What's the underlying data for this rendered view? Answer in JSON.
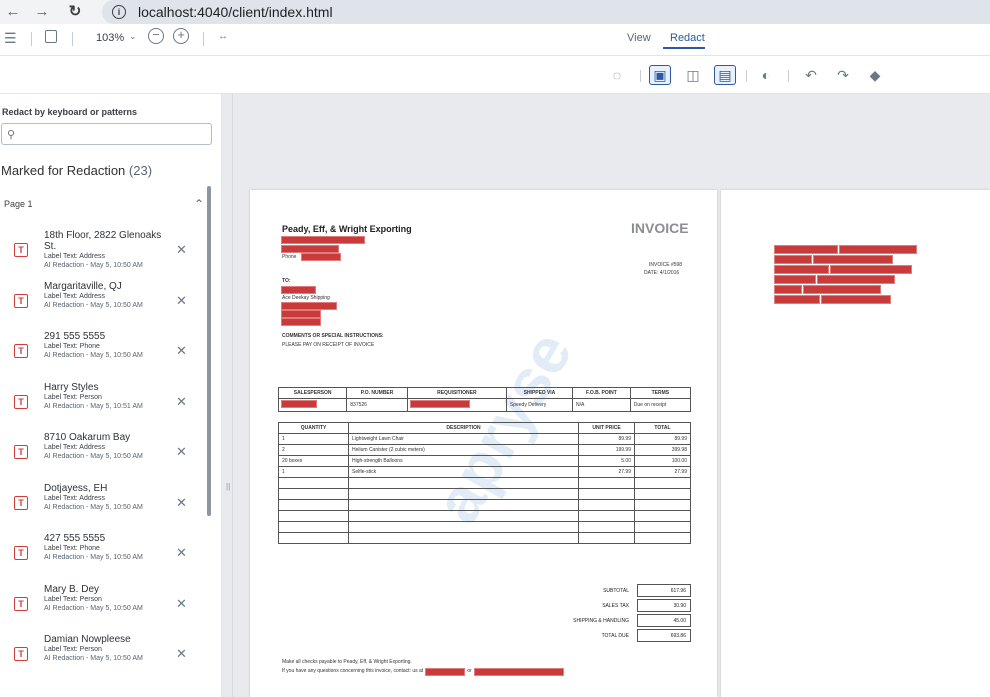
{
  "browser": {
    "url": "localhost:4040/client/index.html",
    "back_icon": "arrow-left-icon",
    "forward_icon": "arrow-right-icon",
    "reload_icon": "reload-icon"
  },
  "header": {
    "zoom": "103%",
    "tabs": [
      {
        "label": "View"
      },
      {
        "label": "Redact"
      }
    ],
    "active_tab": "Redact"
  },
  "sidebar": {
    "title": "Redact by keyboard or patterns",
    "search_placeholder": "",
    "marked_label": "Marked for Redaction",
    "marked_count": "(23)",
    "page_label": "Page 1",
    "items": [
      {
        "title": "18th Floor, 2822 Glenoaks St.",
        "type": "Label Text: Address",
        "meta": "AI Redaction - May 5, 10:50 AM"
      },
      {
        "title": "Margaritaville, QJ",
        "type": "Label Text: Address",
        "meta": "AI Redaction - May 5, 10:50 AM"
      },
      {
        "title": "291 555 5555",
        "type": "Label Text: Phone",
        "meta": "AI Redaction - May 5, 10:50 AM"
      },
      {
        "title": "Harry Styles",
        "type": "Label Text: Person",
        "meta": "AI Redaction - May 5, 10:51 AM"
      },
      {
        "title": "8710 Oakarum Bay",
        "type": "Label Text: Address",
        "meta": "AI Redaction - May 5, 10:50 AM"
      },
      {
        "title": "Dotjayess, EH",
        "type": "Label Text: Address",
        "meta": "AI Redaction - May 5, 10:50 AM"
      },
      {
        "title": "427 555 5555",
        "type": "Label Text: Phone",
        "meta": "AI Redaction - May 5, 10:50 AM"
      },
      {
        "title": "Mary B. Dey",
        "type": "Label Text: Person",
        "meta": "AI Redaction - May 5, 10:50 AM"
      },
      {
        "title": "Damian Nowpleese",
        "type": "Label Text: Person",
        "meta": "AI Redaction - May 5, 10:50 AM"
      }
    ]
  },
  "document": {
    "company": "Peady, Eff, & Wright Exporting",
    "invoice_title": "INVOICE",
    "phone_label": "Phone",
    "invoice_no": "INVOICE #598",
    "date": "DATE: 4/1/2016",
    "to_label": "TO:",
    "to_company": "Ace Deekay Shipping",
    "comments_label": "COMMENTS OR SPECIAL INSTRUCTIONS:",
    "comments_text": "PLEASE PAY ON RECEIPT OF INVOICE",
    "top_table": {
      "headers": [
        "SALESPERSON",
        "P.O. NUMBER",
        "REQUISITIONER",
        "SHIPPED VIA",
        "F.O.B. POINT",
        "TERMS"
      ],
      "row": [
        "",
        "837526",
        "",
        "Speedy Delivery",
        "N/A",
        "Due on receipt"
      ]
    },
    "items_table": {
      "headers": [
        "QUANTITY",
        "DESCRIPTION",
        "UNIT PRICE",
        "TOTAL"
      ],
      "rows": [
        [
          "1",
          "Lightweight Lawn Chair",
          "89.99",
          "89.99"
        ],
        [
          "2",
          "Helium Canister (2 cubic meters)",
          "199.99",
          "399.98"
        ],
        [
          "20 boxes",
          "High-strength Balloons",
          "5.00",
          "100.00"
        ],
        [
          "1",
          "Selfie-stick",
          "27.99",
          "27.99"
        ],
        [
          "",
          "",
          "",
          ""
        ],
        [
          "",
          "",
          "",
          ""
        ],
        [
          "",
          "",
          "",
          ""
        ],
        [
          "",
          "",
          "",
          ""
        ],
        [
          "",
          "",
          "",
          ""
        ],
        [
          "",
          "",
          "",
          ""
        ]
      ]
    },
    "summary": [
      {
        "label": "SUBTOTAL",
        "value": "617.96"
      },
      {
        "label": "SALES TAX",
        "value": "30.90"
      },
      {
        "label": "SHIPPING & HANDLING",
        "value": "45.00"
      },
      {
        "label": "TOTAL DUE",
        "value": "693.86"
      }
    ],
    "footer_line1": "Make all checks payable to Peady, Eff, & Wright Exporting.",
    "footer_line2": "If you have any questions concerning this invoice, contact: us at",
    "footer_or": "or",
    "watermark": "apryse"
  }
}
